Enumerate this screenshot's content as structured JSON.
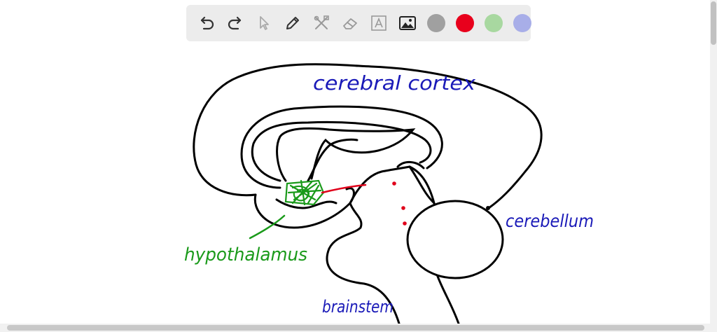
{
  "toolbar": {
    "tools": [
      {
        "name": "undo-icon"
      },
      {
        "name": "redo-icon"
      },
      {
        "name": "select-pointer-icon"
      },
      {
        "name": "pencil-icon"
      },
      {
        "name": "tools-icon"
      },
      {
        "name": "eraser-icon"
      },
      {
        "name": "text-icon"
      },
      {
        "name": "image-icon"
      }
    ],
    "colors": [
      {
        "name": "color-gray",
        "value": "#a0a0a0"
      },
      {
        "name": "color-red",
        "value": "#e8001c"
      },
      {
        "name": "color-light-green",
        "value": "#a8d8a0"
      },
      {
        "name": "color-light-blue",
        "value": "#a8aee8"
      }
    ]
  },
  "drawing": {
    "labels": {
      "cerebral_cortex": "cerebral cortex",
      "cerebellum": "cerebellum",
      "hypothalamus": "hypothalamus",
      "brainstem": "brainstem"
    },
    "colors": {
      "ink": "#000000",
      "blue": "#1a1ab8",
      "green": "#1a9a1a",
      "red": "#e0001a"
    }
  }
}
